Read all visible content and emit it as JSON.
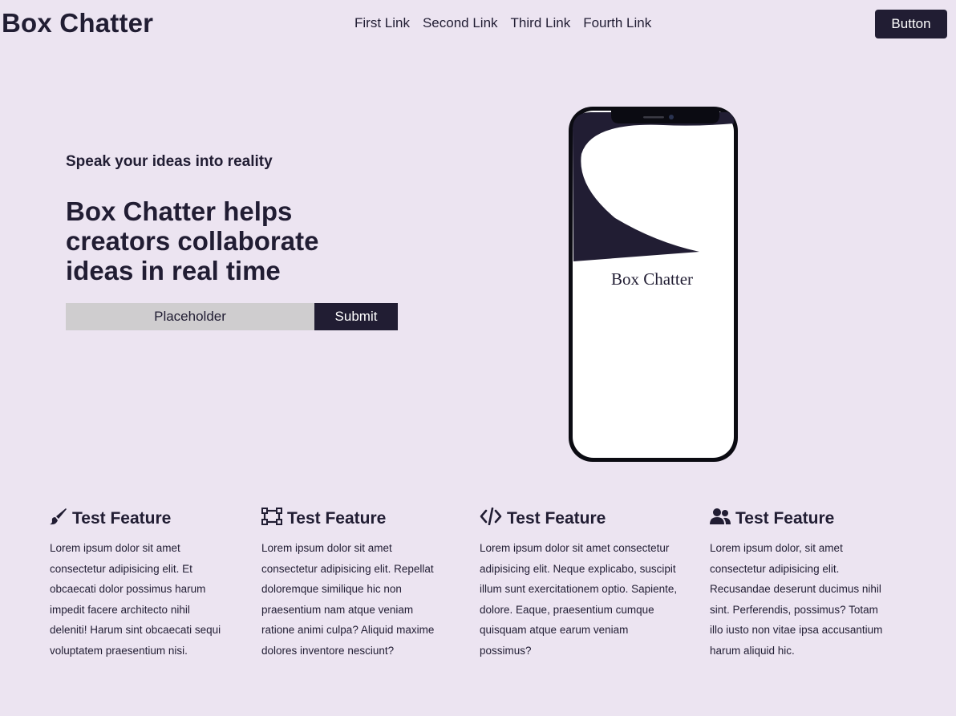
{
  "header": {
    "brand": "Box Chatter",
    "nav": [
      "First Link",
      "Second Link",
      "Third Link",
      "Fourth Link"
    ],
    "button_label": "Button"
  },
  "hero": {
    "tagline": "Speak your ideas into reality",
    "headline": "Box Chatter helps creators collaborate ideas in real time",
    "input_placeholder": "Placeholder",
    "submit_label": "Submit",
    "phone_screen_text": "Box Chatter"
  },
  "features": [
    {
      "icon": "brush-icon",
      "title": "Test Feature",
      "text": "Lorem ipsum dolor sit amet consectetur adipisicing elit. Et obcaecati dolor possimus harum impedit facere architecto nihil deleniti! Harum sint obcaecati sequi voluptatem praesentium nisi."
    },
    {
      "icon": "vector-square-icon",
      "title": "Test Feature",
      "text": "Lorem ipsum dolor sit amet consectetur adipisicing elit. Repellat doloremque similique hic non praesentium nam atque veniam ratione animi culpa? Aliquid maxime dolores inventore nesciunt?"
    },
    {
      "icon": "code-icon",
      "title": "Test Feature",
      "text": "Lorem ipsum dolor sit amet consectetur adipisicing elit. Neque explicabo, suscipit illum sunt exercitationem optio. Sapiente, dolore. Eaque, praesentium cumque quisquam atque earum veniam possimus?"
    },
    {
      "icon": "user-group-icon",
      "title": "Test Feature",
      "text": "Lorem ipsum dolor, sit amet consectetur adipisicing elit. Recusandae deserunt ducimus nihil sint. Perferendis, possimus? Totam illo iusto non vitae ipsa accusantium harum aliquid hic."
    }
  ]
}
